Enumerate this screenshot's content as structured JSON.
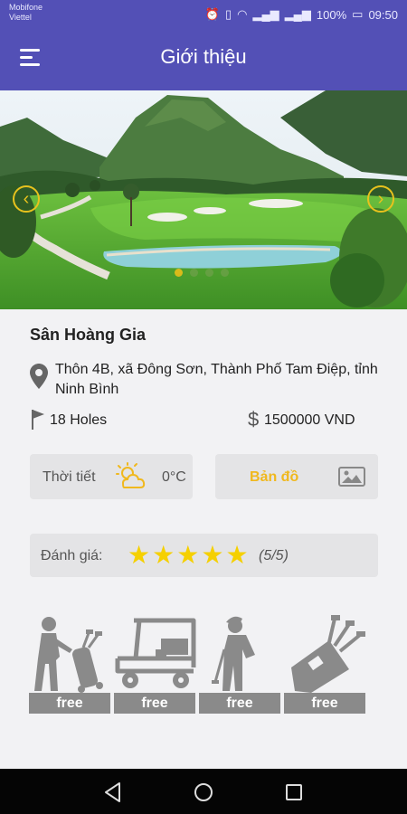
{
  "status_bar": {
    "carrier1": "Mobifone",
    "carrier2": "Viettel",
    "battery": "100%",
    "time": "09:50"
  },
  "header": {
    "title": "Giới thiệu",
    "menu_icon": "hamburger-menu-icon"
  },
  "carousel": {
    "slides_count": 4,
    "active_index": 0
  },
  "course": {
    "name": "Sân Hoàng Gia",
    "address": "Thôn 4B, xã Đông Sơn, Thành Phố Tam Điệp, tỉnh Ninh Bình",
    "holes": "18 Holes",
    "price": "1500000 VND"
  },
  "weather": {
    "label": "Thời tiết",
    "temp": "0°C"
  },
  "map": {
    "label": "Bản đồ"
  },
  "rating": {
    "label": "Đánh giá:",
    "stars": 5,
    "value": "(5/5)"
  },
  "amenities": [
    {
      "icon": "caddie-icon",
      "label": "free"
    },
    {
      "icon": "golf-cart-icon",
      "label": "free"
    },
    {
      "icon": "golfer-icon",
      "label": "free"
    },
    {
      "icon": "golf-bag-icon",
      "label": "free"
    }
  ],
  "colors": {
    "primary": "#5350b6",
    "accent": "#f0b81e",
    "star": "#f5d000"
  }
}
